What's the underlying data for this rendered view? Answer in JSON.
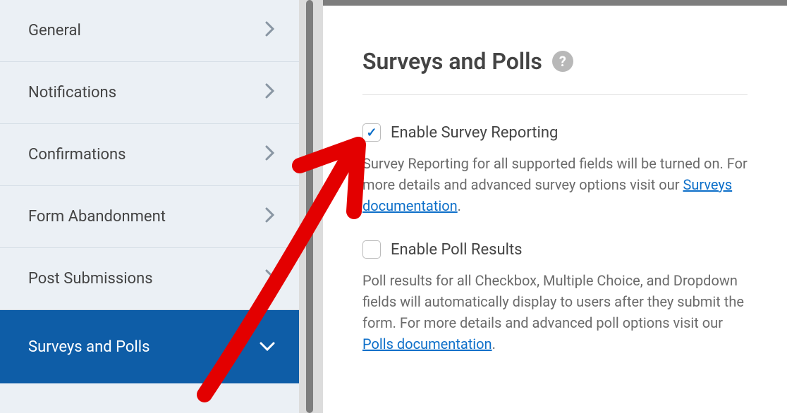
{
  "sidebar": {
    "items": [
      {
        "label": "General"
      },
      {
        "label": "Notifications"
      },
      {
        "label": "Confirmations"
      },
      {
        "label": "Form Abandonment"
      },
      {
        "label": "Post Submissions"
      },
      {
        "label": "Surveys and Polls"
      }
    ]
  },
  "panel": {
    "title": "Surveys and Polls",
    "help_glyph": "?",
    "option1": {
      "label": "Enable Survey Reporting",
      "desc_before": "Survey Reporting for all supported fields will be turned on. For more details and advanced survey options visit our ",
      "link_text": "Surveys documentation",
      "desc_after": "."
    },
    "option2": {
      "label": "Enable Poll Results",
      "desc_before": "Poll results for all Checkbox, Multiple Choice, and Dropdown fields will automatically display to users after they submit the form. For more details and advanced poll options visit our ",
      "link_text": "Polls documentation",
      "desc_after": "."
    }
  }
}
